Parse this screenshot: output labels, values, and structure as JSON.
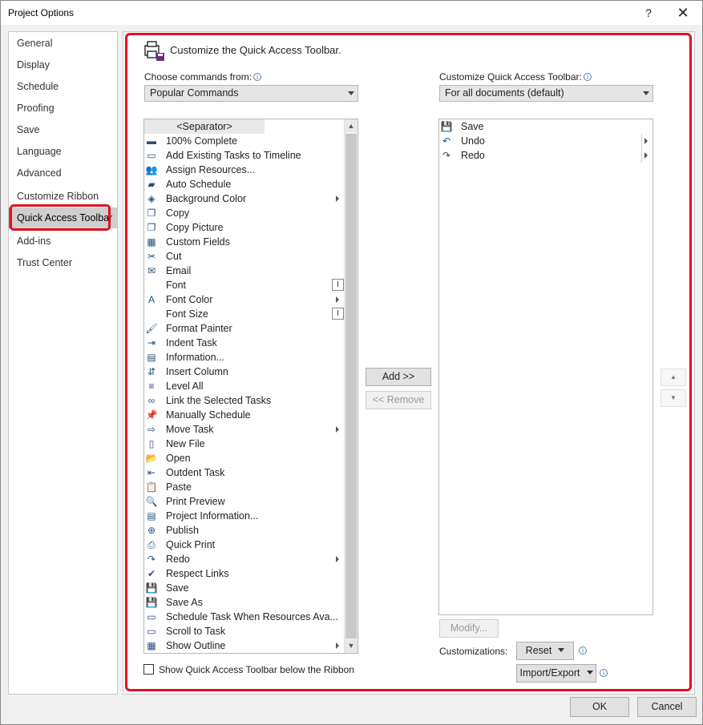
{
  "window": {
    "title": "Project Options",
    "help_glyph": "?",
    "close_glyph": "✕"
  },
  "sidebar": {
    "items": [
      {
        "label": "General"
      },
      {
        "label": "Display"
      },
      {
        "label": "Schedule"
      },
      {
        "label": "Proofing"
      },
      {
        "label": "Save"
      },
      {
        "label": "Language"
      },
      {
        "label": "Advanced"
      },
      {
        "label": "Customize Ribbon"
      },
      {
        "label": "Quick Access Toolbar"
      },
      {
        "label": "Add-ins"
      },
      {
        "label": "Trust Center"
      }
    ],
    "selected_index": 8
  },
  "main": {
    "header": "Customize the Quick Access Toolbar.",
    "choose_label": "Choose commands from:",
    "choose_value": "Popular Commands",
    "customize_label": "Customize Quick Access Toolbar:",
    "customize_value": "For all documents (default)",
    "commands": [
      {
        "label": "<Separator>",
        "icon": ""
      },
      {
        "label": "100% Complete",
        "icon": "▬"
      },
      {
        "label": "Add Existing Tasks to Timeline",
        "icon": "▭"
      },
      {
        "label": "Assign Resources...",
        "icon": "👥"
      },
      {
        "label": "Auto Schedule",
        "icon": "▰"
      },
      {
        "label": "Background Color",
        "icon": "◈",
        "submenu": true
      },
      {
        "label": "Copy",
        "icon": "❐"
      },
      {
        "label": "Copy Picture",
        "icon": "❐"
      },
      {
        "label": "Custom Fields",
        "icon": "▦"
      },
      {
        "label": "Cut",
        "icon": "✂"
      },
      {
        "label": "Email",
        "icon": "✉"
      },
      {
        "label": "Font",
        "icon": "",
        "cursor": true
      },
      {
        "label": "Font Color",
        "icon": "A",
        "submenu": true
      },
      {
        "label": "Font Size",
        "icon": "",
        "cursor": true
      },
      {
        "label": "Format Painter",
        "icon": "🖌"
      },
      {
        "label": "Indent Task",
        "icon": "⇥"
      },
      {
        "label": "Information...",
        "icon": "▤"
      },
      {
        "label": "Insert Column",
        "icon": "⇵"
      },
      {
        "label": "Level All",
        "icon": "≡"
      },
      {
        "label": "Link the Selected Tasks",
        "icon": "∞"
      },
      {
        "label": "Manually Schedule",
        "icon": "📌"
      },
      {
        "label": "Move Task",
        "icon": "⇨",
        "submenu": true
      },
      {
        "label": "New File",
        "icon": "▯"
      },
      {
        "label": "Open",
        "icon": "📂"
      },
      {
        "label": "Outdent Task",
        "icon": "⇤"
      },
      {
        "label": "Paste",
        "icon": "📋"
      },
      {
        "label": "Print Preview",
        "icon": "🔍"
      },
      {
        "label": "Project Information...",
        "icon": "▤"
      },
      {
        "label": "Publish",
        "icon": "⊕"
      },
      {
        "label": "Quick Print",
        "icon": "⎙"
      },
      {
        "label": "Redo",
        "icon": "↷",
        "submenu": true
      },
      {
        "label": "Respect Links",
        "icon": "✔"
      },
      {
        "label": "Save",
        "icon": "💾"
      },
      {
        "label": "Save As",
        "icon": "💾"
      },
      {
        "label": "Schedule Task When Resources Ava...",
        "icon": "▭"
      },
      {
        "label": "Scroll to Task",
        "icon": "▭"
      },
      {
        "label": "Show Outline",
        "icon": "▦",
        "submenu": true
      }
    ],
    "toolbar_items": [
      {
        "label": "Save",
        "icon": "💾"
      },
      {
        "label": "Undo",
        "icon": "↶",
        "submenu": true
      },
      {
        "label": "Redo",
        "icon": "↷",
        "submenu": true
      }
    ],
    "add_label": "Add >>",
    "remove_label": "<< Remove",
    "modify_label": "Modify...",
    "customizations_label": "Customizations:",
    "reset_label": "Reset",
    "import_export_label": "Import/Export",
    "show_below_label": "Show Quick Access Toolbar below the Ribbon",
    "info_glyph": "i"
  },
  "footer": {
    "ok_label": "OK",
    "cancel_label": "Cancel"
  },
  "colors": {
    "highlight_red": "#e01020",
    "selected_nav": "#cfcfcf"
  }
}
